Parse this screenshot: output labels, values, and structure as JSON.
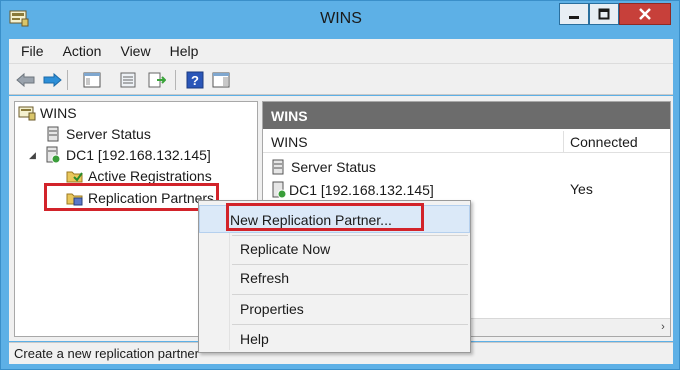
{
  "window": {
    "title": "WINS",
    "app_icon": "wins-console-icon"
  },
  "title_buttons": {
    "minimize": "minimize-icon",
    "maximize": "maximize-icon",
    "close": "close-icon"
  },
  "menu": [
    "File",
    "Action",
    "View",
    "Help"
  ],
  "toolbar": [
    "back-arrow-icon",
    "forward-arrow-icon",
    "show-hide-tree-icon",
    "properties-icon",
    "export-list-icon",
    "help-icon",
    "action-pane-icon"
  ],
  "tree": {
    "root": "WINS",
    "server_status": "Server Status",
    "server": "DC1 [192.168.132.145]",
    "active_registrations": "Active Registrations",
    "replication_partners": "Replication Partners"
  },
  "right_panel": {
    "header": "WINS",
    "columns": [
      "WINS",
      "Connected"
    ],
    "rows": [
      {
        "name": "Server Status",
        "connected": ""
      },
      {
        "name": "DC1 [192.168.132.145]",
        "connected": "Yes"
      }
    ]
  },
  "context_menu": {
    "items": [
      "New Replication Partner...",
      "Replicate Now",
      "Refresh",
      "Properties",
      "Help"
    ]
  },
  "status": "Create a new replication partner",
  "colors": {
    "titlebar": "#5db0e6",
    "highlight_box": "#d2232a",
    "panel_header": "#6c6c6c"
  }
}
